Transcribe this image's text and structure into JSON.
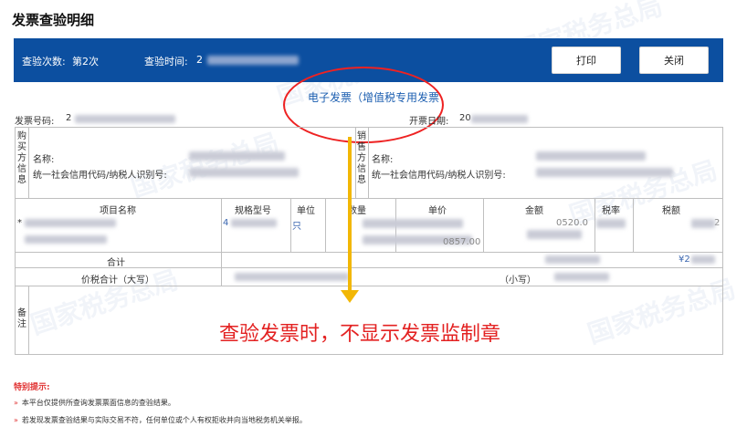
{
  "page": {
    "title": "发票查验明细"
  },
  "toolbar": {
    "check_count_label": "查验次数:",
    "check_count_value": "第2次",
    "check_time_label": "查验时间:",
    "check_time_value": "2",
    "print_label": "打印",
    "close_label": "关闭"
  },
  "invoice": {
    "type_title": "电子发票（增值税专用发票",
    "number_label": "发票号码:",
    "number_value": "2",
    "date_label": "开票日期:",
    "date_value": "20"
  },
  "buyer": {
    "side_label": [
      "购",
      "买",
      "方",
      "信",
      "息"
    ],
    "name_label": "名称:",
    "code_label": "统一社会信用代码/纳税人识别号:"
  },
  "seller": {
    "side_label": [
      "销",
      "售",
      "方",
      "信",
      "息"
    ],
    "name_label": "名称:",
    "code_label": "统一社会信用代码/纳税人识别号:"
  },
  "items_table": {
    "headers": [
      "项目名称",
      "规格型号",
      "单位",
      "数量",
      "单价",
      "金额",
      "税率",
      "税额"
    ],
    "row_prefix": "*",
    "spec_partial": "4",
    "unit_partial": "只",
    "amount_partial": "0520.0",
    "price_partial": "0857.00",
    "tax_partial": "2",
    "tax_total_partial": "¥2",
    "subtotal_label": "合计"
  },
  "totals": {
    "upper_label": "价税合计（大写）",
    "lower_label": "（小写）"
  },
  "remarks": {
    "label": [
      "备",
      "注"
    ]
  },
  "annotation": {
    "text": "查验发票时，不显示发票监制章"
  },
  "tips": {
    "title": "特别提示:",
    "items": [
      "本平台仅提供所查询发票票面信息的查验结果。",
      "若发现发票查验结果与实际交易不符，任何单位或个人有权拒收并向当地税务机关举报。"
    ],
    "bullet": "»"
  },
  "watermark": {
    "text": "国家税务总局"
  },
  "colors": {
    "header_bg": "#0c4fa0",
    "title_link": "#1b5eb0",
    "annotation_red": "#e32222",
    "arrow_yellow": "#f2b705",
    "tips_red": "#e03030"
  }
}
